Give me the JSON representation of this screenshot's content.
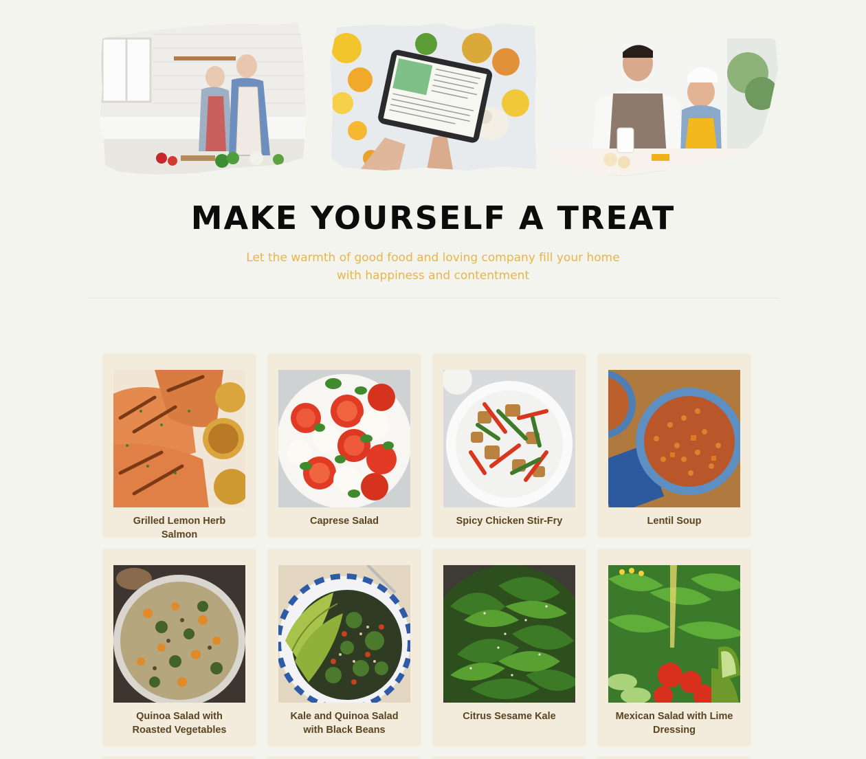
{
  "hero": {
    "title": "MAKE YOURSELF A TREAT",
    "subtitle_line1": "Let the warmth of good food and loving company fill your home",
    "subtitle_line2": "with happiness and contentment",
    "images": [
      {
        "icon": "couple-cooking-photo"
      },
      {
        "icon": "tablet-recipe-photo"
      },
      {
        "icon": "father-son-cooking-photo"
      }
    ]
  },
  "recipes": [
    {
      "title": "Grilled Lemon Herb Salmon",
      "icon": "salmon-photo"
    },
    {
      "title": "Caprese Salad",
      "icon": "caprese-photo"
    },
    {
      "title": "Spicy Chicken Stir-Fry",
      "icon": "stir-fry-photo"
    },
    {
      "title": "Lentil Soup",
      "icon": "lentil-soup-photo"
    },
    {
      "title": "Quinoa Salad with Roasted Vegetables",
      "icon": "quinoa-salad-photo"
    },
    {
      "title": "Kale and Quinoa Salad with Black Beans",
      "icon": "kale-quinoa-photo"
    },
    {
      "title": "Citrus Sesame Kale",
      "icon": "kale-photo"
    },
    {
      "title": "Mexican Salad with Lime Dressing",
      "icon": "mexican-salad-photo"
    }
  ],
  "colors": {
    "background": "#f4f4ef",
    "card": "#f3ebdc",
    "accent": "#e6b54b",
    "title_text": "#5a4522"
  }
}
